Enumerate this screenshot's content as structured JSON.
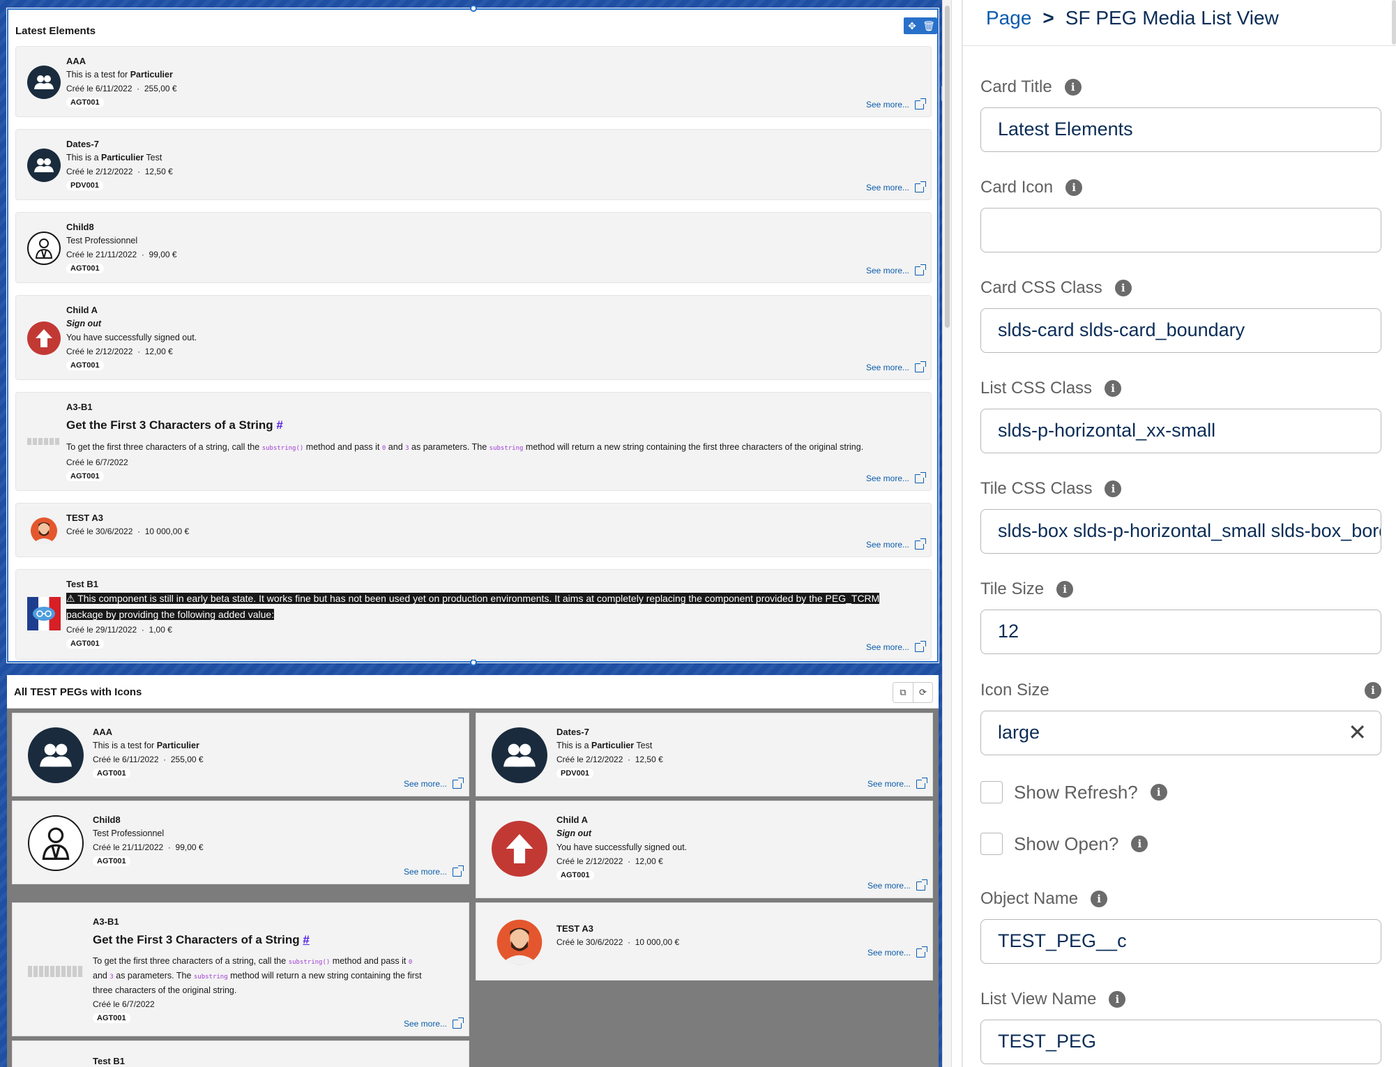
{
  "preview": {
    "card1": {
      "title": "Latest Elements",
      "tiles": [
        {
          "name": "AAA",
          "line_pre": "This is a test for ",
          "line_bold": "Particulier",
          "line_post": "",
          "date": "Créé le 6/11/2022",
          "amount": "255,00 €",
          "badge": "AGT001",
          "see_more": "See more..."
        },
        {
          "name": "Dates-7",
          "line_pre": "This is a ",
          "line_bold": "Particulier",
          "line_post": " Test",
          "date": "Créé le 2/12/2022",
          "amount": "12,50 €",
          "badge": "PDV001",
          "see_more": "See more..."
        },
        {
          "name": "Child8",
          "line": "Test Professionnel",
          "date": "Créé le 21/11/2022",
          "amount": "99,00 €",
          "badge": "AGT001",
          "see_more": "See more..."
        },
        {
          "name": "Child A",
          "line_italic": "Sign out",
          "line": "You have successfully signed out.",
          "date": "Créé le 2/12/2022",
          "amount": "12,00 €",
          "badge": "AGT001",
          "see_more": "See more..."
        },
        {
          "name": "A3-B1",
          "heading": "Get the First 3 Characters of a String",
          "hash": "#",
          "p1": "To get the first three characters of a string, call the ",
          "code1": "substring()",
          "p2": " method and pass it ",
          "code2": "0",
          "p3": " and ",
          "code3": "3",
          "p4": " as parameters. The ",
          "code4": "substring",
          "p5": " method will return a new string containing the first three characters of the original string.",
          "date": "Créé le 6/7/2022",
          "badge": "AGT001",
          "see_more": "See more..."
        },
        {
          "name": "TEST A3",
          "date": "Créé le 30/6/2022",
          "amount": "10 000,00 €",
          "see_more": "See more..."
        },
        {
          "name": "Test B1",
          "warning": "⚠ This component is still in early beta state. It works fine but has not been used yet on production environments. It aims at completely replacing the component provided by the PEG_TCRM package by providing the following added value:",
          "date": "Créé le 29/11/2022",
          "amount": "1,00 €",
          "badge": "AGT001",
          "see_more": "See more..."
        }
      ]
    },
    "card2": {
      "title": "All TEST PEGs with Icons",
      "tiles": [
        {
          "name": "AAA",
          "line_pre": "This is a test for ",
          "line_bold": "Particulier",
          "date": "Créé le 6/11/2022",
          "amount": "255,00 €",
          "badge": "AGT001",
          "see_more": "See more..."
        },
        {
          "name": "Dates-7",
          "line_pre": "This is a ",
          "line_bold": "Particulier",
          "line_post": " Test",
          "date": "Créé le 2/12/2022",
          "amount": "12,50 €",
          "badge": "PDV001",
          "see_more": "See more..."
        },
        {
          "name": "Child8",
          "line": "Test Professionnel",
          "date": "Créé le 21/11/2022",
          "amount": "99,00 €",
          "badge": "AGT001",
          "see_more": "See more..."
        },
        {
          "name": "Child A",
          "line_italic": "Sign out",
          "line": "You have successfully signed out.",
          "date": "Créé le 2/12/2022",
          "amount": "12,00 €",
          "badge": "AGT001",
          "see_more": "See more..."
        },
        {
          "name": "A3-B1",
          "heading": "Get the First 3 Characters of a String",
          "hash": "#",
          "p1": "To get the first three characters of a string, call the ",
          "code1": "substring()",
          "p2": " method and pass it ",
          "code2": "0",
          "p3": " and ",
          "code3": "3",
          "p4": " as parameters. The ",
          "code4": "substring",
          "p5": " method will return a new string containing the first three characters of the original string.",
          "date": "Créé le 6/7/2022",
          "badge": "AGT001",
          "see_more": "See more..."
        },
        {
          "name": "TEST A3",
          "date": "Créé le 30/6/2022",
          "amount": "10 000,00 €",
          "see_more": "See more..."
        },
        {
          "name": "Test B1"
        }
      ]
    }
  },
  "panel": {
    "breadcrumb": {
      "parent": "Page",
      "separator": ">",
      "current": "SF PEG Media List View"
    },
    "fields": {
      "card_title": {
        "label": "Card Title",
        "value": "Latest Elements"
      },
      "card_icon": {
        "label": "Card Icon",
        "value": ""
      },
      "card_css": {
        "label": "Card CSS Class",
        "value": "slds-card slds-card_boundary"
      },
      "list_css": {
        "label": "List CSS Class",
        "value": "slds-p-horizontal_xx-small"
      },
      "tile_css": {
        "label": "Tile CSS Class",
        "value": "slds-box slds-p-horizontal_small slds-box_border"
      },
      "tile_size": {
        "label": "Tile Size",
        "value": "12"
      },
      "icon_size": {
        "label": "Icon Size",
        "value": "large"
      },
      "show_refresh": {
        "label": "Show Refresh?",
        "checked": false
      },
      "show_open": {
        "label": "Show Open?",
        "checked": false
      },
      "object_name": {
        "label": "Object Name",
        "value": "TEST_PEG__c"
      },
      "list_view_name": {
        "label": "List View Name",
        "value": "TEST_PEG"
      }
    },
    "info_glyph": "i"
  },
  "colors": {
    "accent": "#2870c9",
    "link": "#0b5cab",
    "page_bg": "#1e4fa3",
    "tile_bg": "#f3f3f3",
    "grid_bg": "#7c7c7c"
  }
}
